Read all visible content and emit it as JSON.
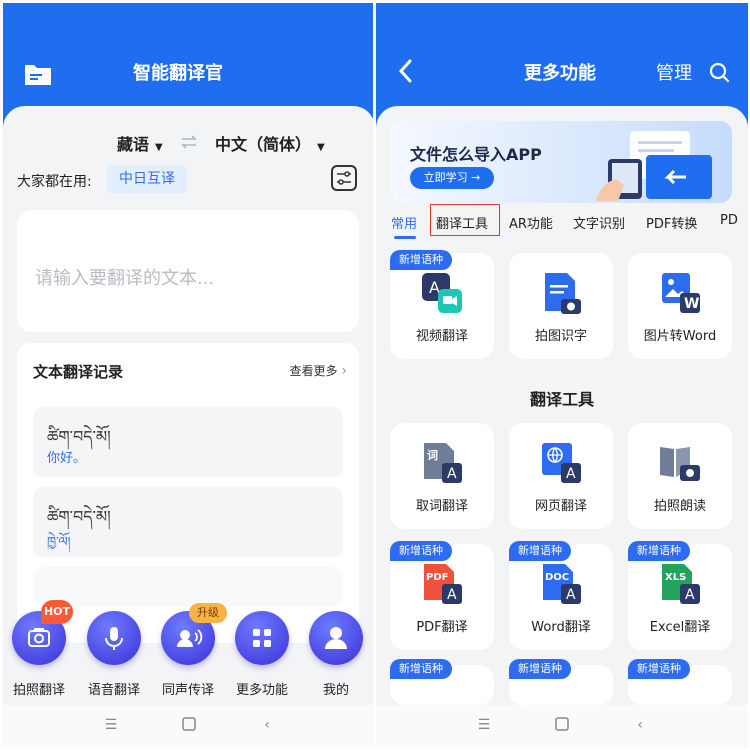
{
  "left": {
    "title": "智能翻译官",
    "source_lang": "藏语",
    "target_lang": "中文（简体）",
    "popular_label": "大家都在用:",
    "popular_chip": "中日互译",
    "placeholder": "请输入要翻译的文本...",
    "history": {
      "title": "文本翻译记录",
      "more": "查看更多",
      "records": [
        {
          "source": "ཚིག་བདེ་མོ།",
          "target": "你好。"
        },
        {
          "source": "ཚིག་བདེ་མོ།",
          "target": "ཁྱེ་ལོ།"
        }
      ]
    },
    "actions": [
      {
        "label": "拍照翻译",
        "icon": "camera-icon"
      },
      {
        "label": "语音翻译",
        "icon": "microphone-icon"
      },
      {
        "label": "同声传译",
        "icon": "simultaneous-icon"
      },
      {
        "label": "更多功能",
        "icon": "grid-icon"
      },
      {
        "label": "我的",
        "icon": "profile-icon"
      }
    ],
    "badge_hot": "HOT",
    "badge_upgrade": "升级"
  },
  "right": {
    "title": "更多功能",
    "manage": "管理",
    "banner": {
      "title": "文件怎么导入APP",
      "button": "立即学习 →"
    },
    "tabs": [
      "常用",
      "翻译工具",
      "AR功能",
      "文字识别",
      "PDF转换",
      "PD"
    ],
    "active_tab": "常用",
    "common_cards": [
      {
        "label": "视频翻译",
        "tag": "新增语种"
      },
      {
        "label": "拍图识字",
        "tag": ""
      },
      {
        "label": "图片转Word",
        "tag": ""
      }
    ],
    "section_title": "翻译工具",
    "tool_cards_row1": [
      {
        "label": "取词翻译"
      },
      {
        "label": "网页翻译"
      },
      {
        "label": "拍照朗读"
      }
    ],
    "tool_cards_row2": [
      {
        "label": "PDF翻译",
        "tag": "新增语种"
      },
      {
        "label": "Word翻译",
        "tag": "新增语种"
      },
      {
        "label": "Excel翻译",
        "tag": "新增语种"
      }
    ],
    "row3_tags": [
      "新增语种",
      "新增语种",
      "新增语种"
    ],
    "file_badges": {
      "pdf": "PDF",
      "doc": "DOC",
      "xls": "XLS",
      "word": "W",
      "ci": "词",
      "a": "A"
    }
  },
  "colors": {
    "brand": "#1f6ef0",
    "accent": "#2d6cf0",
    "hot": "#ff5a36",
    "upgrade": "#f7b346"
  }
}
